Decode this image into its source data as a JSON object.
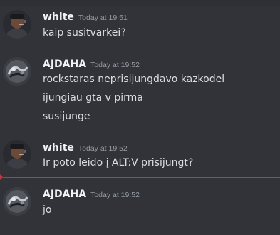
{
  "messages": [
    {
      "username": "white",
      "timestamp": "Today at 19:51",
      "avatar": "dark-photo-avatar",
      "lines": [
        "kaip susitvarkei?"
      ]
    },
    {
      "username": "AJDAHA",
      "timestamp": "Today at 19:52",
      "avatar": "graffiti-avatar",
      "lines": [
        "rockstaras neprisijungdavo kazkodel",
        "ijungiau gta v pirma",
        "susijunge"
      ]
    },
    {
      "username": "white",
      "timestamp": "Today at 19:52",
      "avatar": "dark-photo-avatar",
      "lines": [
        "Ir poto leido į ALT:V prisijungt?"
      ]
    },
    {
      "username": "AJDAHA",
      "timestamp": "Today at 19:52",
      "avatar": "graffiti-avatar",
      "lines": [
        "jo"
      ]
    }
  ],
  "colors": {
    "background": "#313338",
    "username": "#f2f3f5",
    "text": "#dbdee1",
    "timestamp": "#949ba4",
    "new_messages_divider": "#c0373e"
  }
}
